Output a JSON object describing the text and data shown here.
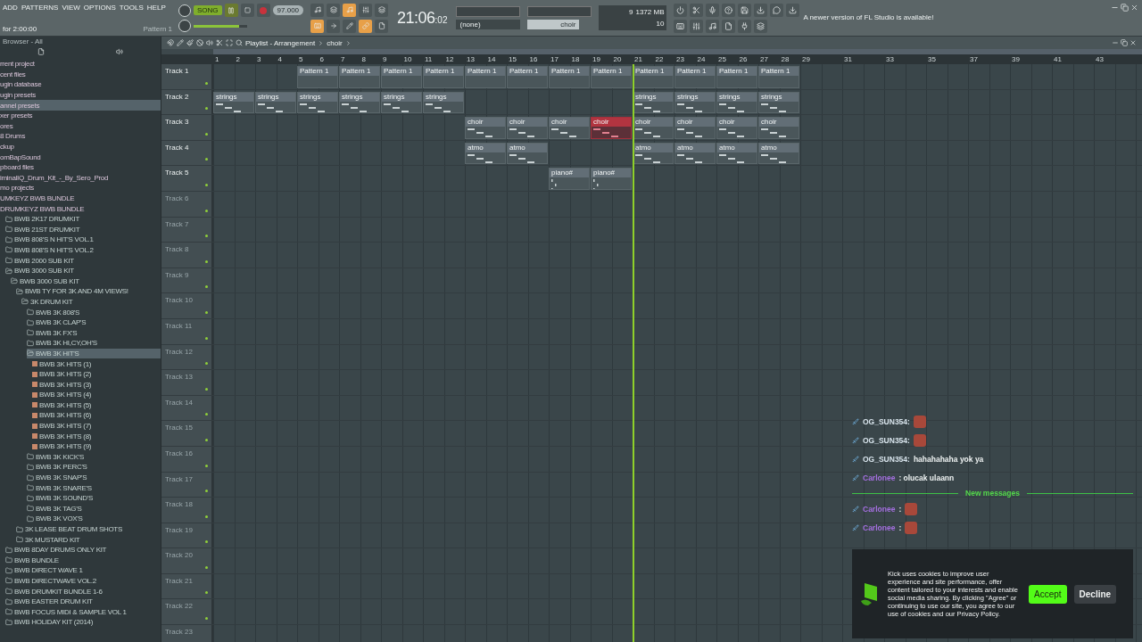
{
  "menu": [
    "ADD",
    "PATTERNS",
    "VIEW",
    "OPTIONS",
    "TOOLS",
    "HELP"
  ],
  "hint_left": "for 2:00:00",
  "pattern_label": "Pattern 1",
  "transport": {
    "mode": "SONG",
    "tempo": "97.000",
    "time": "21:06",
    "time_small": ":02",
    "volume": {
      "level": 0.85
    }
  },
  "toggles_top": [
    {
      "on": false
    },
    {
      "on": false
    },
    {
      "on": true
    },
    {
      "on": false
    },
    {
      "on": false
    }
  ],
  "toggles_bottom": [
    {
      "on": true
    },
    {
      "on": false
    },
    {
      "on": false
    },
    {
      "on": true
    },
    {
      "on": false
    }
  ],
  "monitor": {
    "voices": "9",
    "ram": "1372 MB",
    "polyphony": "10"
  },
  "pattern_selector": {
    "channel": "(none)",
    "pattern": "choir"
  },
  "hint_bar": "A newer version of FL Studio is available!",
  "browser": {
    "title": "Browser - All",
    "items": [
      {
        "label": "rrent project",
        "kind": "category",
        "selected": false
      },
      {
        "label": "cent files",
        "kind": "category",
        "selected": false
      },
      {
        "label": "ugin database",
        "kind": "category",
        "selected": false
      },
      {
        "label": "ugin presets",
        "kind": "category",
        "selected": false
      },
      {
        "label": "annel presets",
        "kind": "category",
        "selected": true
      },
      {
        "label": "xer presets",
        "kind": "category",
        "selected": false
      },
      {
        "label": "ores",
        "kind": "category",
        "selected": false
      },
      {
        "label": "8 Drums",
        "kind": "category",
        "selected": false
      },
      {
        "label": "ckup",
        "kind": "category",
        "selected": false
      },
      {
        "label": "omBapSound",
        "kind": "category",
        "selected": false
      },
      {
        "label": "pboard files",
        "kind": "category",
        "selected": false
      },
      {
        "label": "iminalIQ_Drum_Kit_-_By_Sero_Prod",
        "kind": "category",
        "selected": false
      },
      {
        "label": "mo projects",
        "kind": "category",
        "selected": false
      },
      {
        "label": "UMKEYZ BWB BUNDLE",
        "kind": "category",
        "selected": false
      },
      {
        "label": "DRUMKEYZ BWB BUNDLE",
        "kind": "category",
        "selected": false,
        "children": [
          {
            "label": "BWB 2K17 DRUMKIT",
            "kind": "folder",
            "selected": false
          },
          {
            "label": "BWB 21ST DRUMKIT",
            "kind": "folder",
            "selected": false
          },
          {
            "label": "BWB 808'S N HIT'S VOL.1",
            "kind": "folder",
            "selected": false
          },
          {
            "label": "BWB 808'S N HIT'S VOL.2",
            "kind": "folder",
            "selected": false
          },
          {
            "label": "BWB 2000 SUB KIT",
            "kind": "folder",
            "selected": false
          },
          {
            "label": "BWB 3000 SUB KIT",
            "kind": "folder",
            "selected": false,
            "children": [
              {
                "label": "BWB 3000 SUB KIT",
                "kind": "folder",
                "selected": false,
                "children": [
                  {
                    "label": "BWB TY FOR 3K AND 4M VIEWS!",
                    "kind": "folder",
                    "selected": false,
                    "children": [
                      {
                        "label": "3K DRUM KIT",
                        "kind": "folder",
                        "selected": false,
                        "children": [
                          {
                            "label": "BWB 3K 808'S",
                            "kind": "folder",
                            "selected": false
                          },
                          {
                            "label": "BWB 3K CLAP'S",
                            "kind": "folder",
                            "selected": false
                          },
                          {
                            "label": "BWB 3K FX'S",
                            "kind": "folder",
                            "selected": false
                          },
                          {
                            "label": "BWB 3K HI,CY,OH'S",
                            "kind": "folder",
                            "selected": false
                          },
                          {
                            "label": "BWB 3K HIT'S",
                            "kind": "folder",
                            "selected": true,
                            "children": [
                              {
                                "label": "BWB 3K HITS (1)",
                                "kind": "sample",
                                "selected": false
                              },
                              {
                                "label": "BWB 3K HITS (2)",
                                "kind": "sample",
                                "selected": false
                              },
                              {
                                "label": "BWB 3K HITS (3)",
                                "kind": "sample",
                                "selected": false
                              },
                              {
                                "label": "BWB 3K HITS (4)",
                                "kind": "sample",
                                "selected": false
                              },
                              {
                                "label": "BWB 3K HITS (5)",
                                "kind": "sample",
                                "selected": false
                              },
                              {
                                "label": "BWB 3K HITS (6)",
                                "kind": "sample",
                                "selected": false
                              },
                              {
                                "label": "BWB 3K HITS (7)",
                                "kind": "sample",
                                "selected": false
                              },
                              {
                                "label": "BWB 3K HITS (8)",
                                "kind": "sample",
                                "selected": false
                              },
                              {
                                "label": "BWB 3K HITS (9)",
                                "kind": "sample",
                                "selected": false
                              }
                            ]
                          },
                          {
                            "label": "BWB 3K KICK'S",
                            "kind": "folder",
                            "selected": false
                          },
                          {
                            "label": "BWB 3K PERC'S",
                            "kind": "folder",
                            "selected": false
                          },
                          {
                            "label": "BWB 3K SNAP'S",
                            "kind": "folder",
                            "selected": false
                          },
                          {
                            "label": "BWB 3K SNARE'S",
                            "kind": "folder",
                            "selected": false
                          },
                          {
                            "label": "BWB 3K SOUND'S",
                            "kind": "folder",
                            "selected": false
                          },
                          {
                            "label": "BWB 3K TAG'S",
                            "kind": "folder",
                            "selected": false
                          },
                          {
                            "label": "BWB 3K VOX'S",
                            "kind": "folder",
                            "selected": false
                          }
                        ]
                      }
                    ]
                  },
                  {
                    "label": "3K LEASE BEAT DRUM SHOTS",
                    "kind": "folder",
                    "selected": false
                  },
                  {
                    "label": "3K MUSTARD KIT",
                    "kind": "folder",
                    "selected": false
                  }
                ]
              }
            ]
          },
          {
            "label": "BWB 8DAY DRUMS ONLY KIT",
            "kind": "folder",
            "selected": false
          },
          {
            "label": "BWB BUNDLE",
            "kind": "folder",
            "selected": false
          },
          {
            "label": "BWB DIRECT WAVE 1",
            "kind": "folder",
            "selected": false
          },
          {
            "label": "BWB DIRECTWAVE VOL.2",
            "kind": "folder",
            "selected": false
          },
          {
            "label": "BWB DRUMKIT BUNDLE 1-6",
            "kind": "folder",
            "selected": false
          },
          {
            "label": "BWB EASTER DRUM KIT",
            "kind": "folder",
            "selected": false
          },
          {
            "label": "BWB FOCUS MIDI & SAMPLE VOL 1",
            "kind": "folder",
            "selected": false
          },
          {
            "label": "BWB HOLIDAY KIT (2014)",
            "kind": "folder",
            "selected": false
          }
        ]
      }
    ]
  },
  "playlist": {
    "title": "Playlist - Arrangement",
    "breadcrumb": "choir",
    "ruler": [
      "1",
      "2",
      "3",
      "4",
      "5",
      "6",
      "7",
      "8",
      "9",
      "10",
      "11",
      "12",
      "13",
      "14",
      "15",
      "16",
      "17",
      "18",
      "19",
      "20",
      "21",
      "22",
      "23",
      "24",
      "25",
      "26",
      "27",
      "28",
      "29",
      "31",
      "33",
      "35",
      "37",
      "39",
      "41",
      "43"
    ],
    "tracks": [
      {
        "name": "Track 1",
        "slots": [
          {
            "kind": "gap"
          },
          {
            "kind": "gap"
          },
          {
            "label": "Pattern 1",
            "kind": "plain",
            "selected": false
          },
          {
            "label": "Pattern 1",
            "kind": "plain",
            "selected": false
          },
          {
            "label": "Pattern 1",
            "kind": "plain",
            "selected": false
          },
          {
            "label": "Pattern 1",
            "kind": "plain",
            "selected": false
          },
          {
            "label": "Pattern 1",
            "kind": "plain",
            "selected": false
          },
          {
            "label": "Pattern 1",
            "kind": "plain",
            "selected": false
          },
          {
            "label": "Pattern 1",
            "kind": "plain",
            "selected": false
          },
          {
            "label": "Pattern 1",
            "kind": "plain",
            "selected": false
          },
          {
            "label": "Pattern 1",
            "kind": "plain",
            "selected": false
          },
          {
            "label": "Pattern 1",
            "kind": "plain",
            "selected": false
          },
          {
            "label": "Pattern 1",
            "kind": "plain",
            "selected": false
          },
          {
            "label": "Pattern 1",
            "kind": "plain",
            "selected": false
          }
        ]
      },
      {
        "name": "Track 2",
        "slots": [
          {
            "label": "strings",
            "kind": "notes",
            "selected": false
          },
          {
            "label": "strings",
            "kind": "notes",
            "selected": false
          },
          {
            "label": "strings",
            "kind": "notes",
            "selected": false
          },
          {
            "label": "strings",
            "kind": "notes",
            "selected": false
          },
          {
            "label": "strings",
            "kind": "notes",
            "selected": false
          },
          {
            "label": "strings",
            "kind": "notes",
            "selected": false
          },
          {
            "kind": "gap"
          },
          {
            "kind": "gap"
          },
          {
            "kind": "gap"
          },
          {
            "kind": "gap"
          },
          {
            "label": "strings",
            "kind": "notes",
            "selected": false
          },
          {
            "label": "strings",
            "kind": "notes",
            "selected": false
          },
          {
            "label": "strings",
            "kind": "notes",
            "selected": false
          },
          {
            "label": "strings",
            "kind": "notes",
            "selected": false
          }
        ]
      },
      {
        "name": "Track 3",
        "slots": [
          {
            "kind": "gap"
          },
          {
            "kind": "gap"
          },
          {
            "kind": "gap"
          },
          {
            "kind": "gap"
          },
          {
            "kind": "gap"
          },
          {
            "kind": "gap"
          },
          {
            "label": "choir",
            "kind": "notes",
            "selected": false
          },
          {
            "label": "choir",
            "kind": "notes",
            "selected": false
          },
          {
            "label": "choir",
            "kind": "notes",
            "selected": false
          },
          {
            "label": "choir",
            "kind": "notes",
            "selected": true
          },
          {
            "label": "choir",
            "kind": "notes",
            "selected": false
          },
          {
            "label": "choir",
            "kind": "notes",
            "selected": false
          },
          {
            "label": "choir",
            "kind": "notes",
            "selected": false
          },
          {
            "label": "choir",
            "kind": "notes",
            "selected": false
          }
        ]
      },
      {
        "name": "Track 4",
        "slots": [
          {
            "kind": "gap"
          },
          {
            "kind": "gap"
          },
          {
            "kind": "gap"
          },
          {
            "kind": "gap"
          },
          {
            "kind": "gap"
          },
          {
            "kind": "gap"
          },
          {
            "label": "atmo",
            "kind": "notes",
            "selected": false
          },
          {
            "label": "atmo",
            "kind": "notes",
            "selected": false
          },
          {
            "kind": "gap"
          },
          {
            "kind": "gap"
          },
          {
            "label": "atmo",
            "kind": "notes",
            "selected": false
          },
          {
            "label": "atmo",
            "kind": "notes",
            "selected": false
          },
          {
            "label": "atmo",
            "kind": "notes",
            "selected": false
          },
          {
            "label": "atmo",
            "kind": "notes",
            "selected": false
          }
        ]
      },
      {
        "name": "Track 5",
        "slots": [
          {
            "kind": "gap"
          },
          {
            "kind": "gap"
          },
          {
            "kind": "gap"
          },
          {
            "kind": "gap"
          },
          {
            "kind": "gap"
          },
          {
            "kind": "gap"
          },
          {
            "kind": "gap"
          },
          {
            "kind": "gap"
          },
          {
            "label": "piano#",
            "kind": "ticks",
            "selected": false
          },
          {
            "label": "piano#",
            "kind": "ticks",
            "selected": false
          }
        ]
      },
      {
        "name": "Track 6"
      },
      {
        "name": "Track 7"
      },
      {
        "name": "Track 8"
      },
      {
        "name": "Track 9"
      },
      {
        "name": "Track 10"
      },
      {
        "name": "Track 11"
      },
      {
        "name": "Track 12"
      },
      {
        "name": "Track 13"
      },
      {
        "name": "Track 14"
      },
      {
        "name": "Track 15"
      },
      {
        "name": "Track 16"
      },
      {
        "name": "Track 17"
      },
      {
        "name": "Track 18"
      },
      {
        "name": "Track 19"
      },
      {
        "name": "Track 20"
      },
      {
        "name": "Track 21"
      },
      {
        "name": "Track 22"
      },
      {
        "name": "Track 23"
      }
    ]
  },
  "chat": {
    "messages": [
      {
        "user": "OG_SUN354:",
        "kind": "emote",
        "color": "#d8e4ec"
      },
      {
        "user": "OG_SUN354:",
        "kind": "emote",
        "color": "#d8e4ec"
      },
      {
        "user": "OG_SUN354:",
        "kind": "text",
        "text": "hahahahaha yok ya",
        "color": "#d8e4ec"
      },
      {
        "user": "Carlonee",
        "kind": "text",
        "text": ": olucak ulaann",
        "color": "#a46fe0"
      },
      {
        "kind": "divider",
        "text": "New messages"
      },
      {
        "user": "Carlonee",
        "kind": "emote",
        "text": ":",
        "color": "#a46fe0"
      },
      {
        "user": "Carlonee",
        "kind": "emote",
        "text": ":",
        "color": "#a46fe0"
      }
    ]
  },
  "cookie_banner": {
    "text": "Kick uses cookies to improve user experience and site performance, offer content tailored to your interests and enable social media sharing. By clicking \"Agree\" or continuing to use our site, you agree to our use of cookies and our Privacy Policy.",
    "accept": "Accept",
    "decline": "Decline"
  }
}
